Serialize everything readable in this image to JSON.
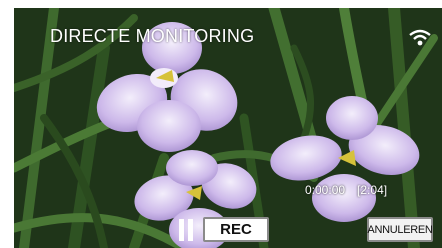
{
  "screen": {
    "title": "DIRECTE MONITORING",
    "status_icon": "wifi-icon"
  },
  "recording": {
    "elapsed": "0:00:00",
    "remaining": "[2:04]"
  },
  "controls": {
    "pause_icon": "pause-icon",
    "rec_label": "REC",
    "cancel_label": "ANNULEREN"
  },
  "colors": {
    "foliage": "#1e3218",
    "iris_petal": "#c9b6e6",
    "button_bg": "#ffffff",
    "button_border": "#8a8a8a"
  }
}
